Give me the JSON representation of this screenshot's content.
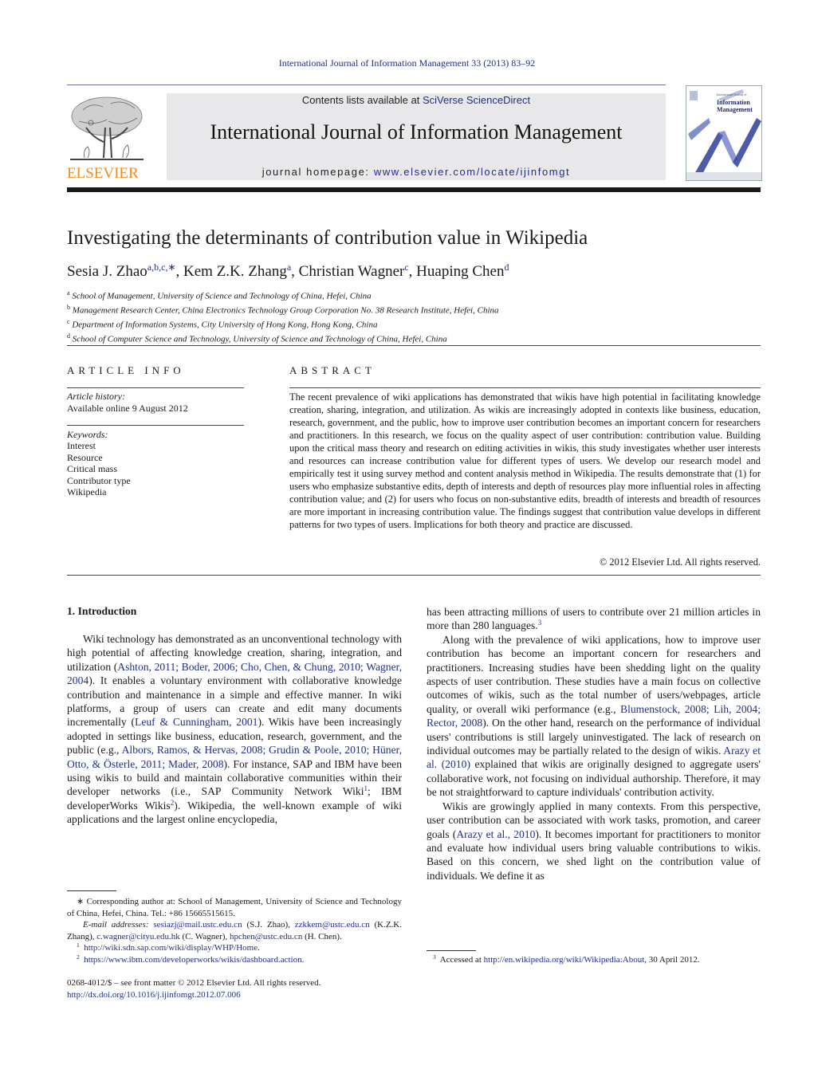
{
  "running_head": "International Journal of Information Management 33 (2013) 83–92",
  "publisher": {
    "logo_word": "ELSEVIER",
    "logo_color": "#f08c1e"
  },
  "masthead": {
    "contents_prefix": "Contents lists available at ",
    "contents_link": "SciVerse ScienceDirect",
    "journal_title": "International Journal of Information Management",
    "homepage_prefix": "journal homepage: ",
    "homepage_link": "www.elsevier.com/locate/ijinfomgt"
  },
  "cover": {
    "pre_title": "International Journal of",
    "title_line1": "Information",
    "title_line2": "Management"
  },
  "article": {
    "title": "Investigating the determinants of contribution value in Wikipedia",
    "authors": [
      {
        "name": "Sesia J. Zhao",
        "marks": "a,b,c,∗",
        "sep": ", "
      },
      {
        "name": "Kem Z.K. Zhang",
        "marks": "a",
        "sep": ", "
      },
      {
        "name": "Christian Wagner",
        "marks": "c",
        "sep": ", "
      },
      {
        "name": "Huaping Chen",
        "marks": "d",
        "sep": ""
      }
    ],
    "affiliations": [
      {
        "mark": "a",
        "text": "School of Management, University of Science and Technology of China, Hefei, China"
      },
      {
        "mark": "b",
        "text": "Management Research Center, China Electronics Technology Group Corporation No. 38 Research Institute, Hefei, China"
      },
      {
        "mark": "c",
        "text": "Department of Information Systems, City University of Hong Kong, Hong Kong, China"
      },
      {
        "mark": "d",
        "text": "School of Computer Science and Technology, University of Science and Technology of China, Hefei, China"
      }
    ]
  },
  "article_info": {
    "heading": "ARTICLE INFO",
    "history_label": "Article history:",
    "history_value": "Available online 9 August 2012",
    "keywords_label": "Keywords:",
    "keywords": [
      "Interest",
      "Resource",
      "Critical mass",
      "Contributor type",
      "Wikipedia"
    ]
  },
  "abstract": {
    "heading": "ABSTRACT",
    "text": "The recent prevalence of wiki applications has demonstrated that wikis have high potential in facilitating knowledge creation, sharing, integration, and utilization. As wikis are increasingly adopted in contexts like business, education, research, government, and the public, how to improve user contribution becomes an important concern for researchers and practitioners. In this research, we focus on the quality aspect of user contribution: contribution value. Building upon the critical mass theory and research on editing activities in wikis, this study investigates whether user interests and resources can increase contribution value for different types of users. We develop our research model and empirically test it using survey method and content analysis method in Wikipedia. The results demonstrate that (1) for users who emphasize substantive edits, depth of interests and depth of resources play more influential roles in affecting contribution value; and (2) for users who focus on non-substantive edits, breadth of interests and breadth of resources are more important in increasing contribution value. The findings suggest that contribution value develops in different patterns for two types of users. Implications for both theory and practice are discussed.",
    "copyright": "© 2012 Elsevier Ltd. All rights reserved."
  },
  "body": {
    "section_heading": "1.  Introduction",
    "left_p1": [
      {
        "t": "Wiki technology has demonstrated as an unconventional technology with high potential of affecting knowledge creation, sharing, integration, and utilization ("
      },
      {
        "l": "Ashton, 2011; Boder, 2006; Cho, Chen, & Chung, 2010; Wagner, 2004"
      },
      {
        "t": "). It enables a voluntary environment with collaborative knowledge contribution and maintenance in a simple and effective manner. In wiki platforms, a group of users can create and edit many documents incrementally ("
      },
      {
        "l": "Leuf & Cunningham, 2001"
      },
      {
        "t": "). Wikis have been increasingly adopted in settings like business, education, research, government, and the public (e.g., "
      },
      {
        "l": "Albors, Ramos, & Hervas, 2008; Grudin & Poole, 2010; Hüner, Otto, & Österle, 2011; Mader, 2008"
      },
      {
        "t": "). For instance, SAP and IBM have been using wikis to build and maintain collaborative communities within their developer networks (i.e., SAP Community Network Wiki"
      },
      {
        "s": "1"
      },
      {
        "t": "; IBM developerWorks Wikis"
      },
      {
        "s": "2"
      },
      {
        "t": "). Wikipedia, the well-known example of wiki applications and the largest online encyclopedia,"
      }
    ],
    "right_p1": [
      {
        "t": "has been attracting millions of users to contribute over 21 million articles in more than 280 languages."
      },
      {
        "s": "3"
      }
    ],
    "right_p2": [
      {
        "t": "Along with the prevalence of wiki applications, how to improve user contribution has become an important concern for researchers and practitioners. Increasing studies have been shedding light on the quality aspects of user contribution. These studies have a main focus on collective outcomes of wikis, such as the total number of users/webpages, article quality, or overall wiki performance (e.g., "
      },
      {
        "l": "Blumenstock, 2008; Lih, 2004; Rector, 2008"
      },
      {
        "t": "). On the other hand, research on the performance of individual users' contributions is still largely uninvestigated. The lack of research on individual outcomes may be partially related to the design of wikis. "
      },
      {
        "l": "Arazy et al. (2010)"
      },
      {
        "t": " explained that wikis are originally designed to aggregate users' collaborative work, not focusing on individual authorship. Therefore, it may be not straightforward to capture individuals' contribution activity."
      }
    ],
    "right_p3": [
      {
        "t": "Wikis are growingly applied in many contexts. From this perspective, user contribution can be associated with work tasks, promotion, and career goals ("
      },
      {
        "l": "Arazy et al., 2010"
      },
      {
        "t": "). It becomes important for practitioners to monitor and evaluate how individual users bring valuable contributions to wikis. Based on this concern, we shed light on the contribution value of individuals. We define it as"
      }
    ]
  },
  "footnotes": {
    "corresponding": "∗ Corresponding author at: School of Management, University of Science and Technology of China, Hefei, China. Tel.: +86 15665515615.",
    "email_label": "E-mail addresses:",
    "emails": [
      {
        "addr": "sesiazj@mail.ustc.edu.cn",
        "who": " (S.J. Zhao), "
      },
      {
        "addr": "zzkkem@ustc.edu.cn",
        "who": " (K.Z.K. Zhang), "
      },
      {
        "addr": "c.wagner@cityu.edu.hk",
        "who": " (C. Wagner), "
      },
      {
        "addr": "hpchen@ustc.edu.cn",
        "who": " (H. Chen)."
      }
    ],
    "fn1_mark": "1",
    "fn1_url": "http://wiki.sdn.sap.com/wiki/display/WHP/Home",
    "fn2_mark": "2",
    "fn2_url": "https://www.ibm.com/developerworks/wikis/dashboard.action",
    "fn3_mark": "3",
    "fn3_prefix": "Accessed at ",
    "fn3_url": "http://en.wikipedia.org/wiki/Wikipedia:About",
    "fn3_suffix": ", 30 April 2012.",
    "front_matter": "0268-4012/$ – see front matter © 2012 Elsevier Ltd. All rights reserved.",
    "doi": "http://dx.doi.org/10.1016/j.ijinfomgt.2012.07.006"
  },
  "colors": {
    "link": "#1f2f8a",
    "masthead_bg": "#e8e8ea",
    "elsevier_orange": "#f08c1e"
  }
}
